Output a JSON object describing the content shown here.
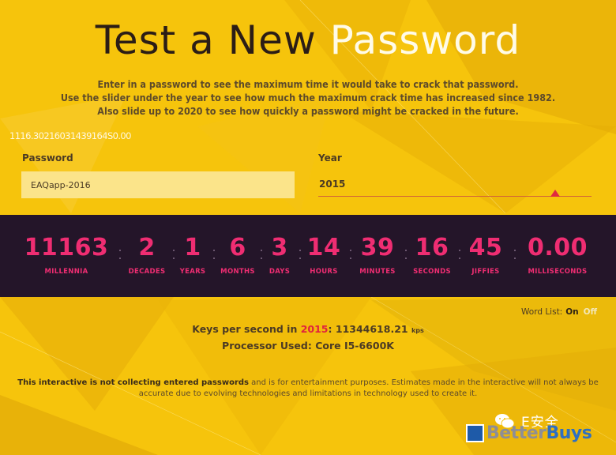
{
  "header": {
    "title_part1": "Test a New ",
    "title_part2": "Password"
  },
  "intro": {
    "line1": "Enter in a password to see the maximum time it would take to crack that password.",
    "line2": "Use the slider under the year to see how much the maximum crack time has increased since 1982.",
    "line3": "Also slide up to 2020 to see how quickly a password might be cracked in the future."
  },
  "hash_readout": "1116.30216031439164S0.00",
  "form": {
    "password_label": "Password",
    "password_value": "EAQapp-2016",
    "year_label": "Year",
    "year_value": "2015",
    "year_slider": {
      "min": 1982,
      "max": 2020,
      "value": 2015
    }
  },
  "crack_time": [
    {
      "value": "11163",
      "unit": "MILLENNIA"
    },
    {
      "value": "2",
      "unit": "DECADES"
    },
    {
      "value": "1",
      "unit": "YEARS"
    },
    {
      "value": "6",
      "unit": "MONTHS"
    },
    {
      "value": "3",
      "unit": "DAYS"
    },
    {
      "value": "14",
      "unit": "HOURS"
    },
    {
      "value": "39",
      "unit": "MINUTES"
    },
    {
      "value": "16",
      "unit": "SECONDS"
    },
    {
      "value": "45",
      "unit": "JIFFIES"
    },
    {
      "value": "0.00",
      "unit": "MILLISECONDS"
    }
  ],
  "word_list": {
    "label": "Word List:",
    "on": "On",
    "off": "Off"
  },
  "stats": {
    "kps_prefix": "Keys per second in ",
    "kps_year": "2015",
    "kps_value": ": 11344618.21 ",
    "kps_unit": "kps",
    "processor_label": "Processor Used: ",
    "processor_value": "Core I5-6600K"
  },
  "disclaimer": {
    "bold": "This interactive is not collecting entered passwords",
    "rest": " and is for entertainment purposes. Estimates made in the interactive will not always be accurate due to evolving technologies and limitations in technology used to create it."
  },
  "watermark": "E安全",
  "logo": {
    "part1": "Better",
    "part2": "Buys"
  },
  "colors": {
    "background": "#f6c40c",
    "band": "#241529",
    "digits": "#ef2d72",
    "accent_red": "#e0223e"
  }
}
